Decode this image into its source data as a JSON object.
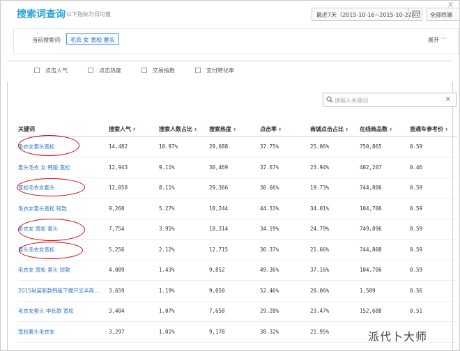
{
  "header": {
    "title": "搜索词查询",
    "subtitle": "以下指标为日均值",
    "date_range": "最近7天（2015-10-16~2015-10-22）",
    "terminal": "全部终端",
    "close": "X"
  },
  "current_search": {
    "label": "当前搜索词:",
    "tag": "毛衣 女 宽松 套头",
    "expand": "展开"
  },
  "filters": [
    {
      "label": "点击人气"
    },
    {
      "label": "点击热度"
    },
    {
      "label": "交易指数"
    },
    {
      "label": "支付转化率"
    }
  ],
  "search": {
    "placeholder": "请输入关键词",
    "clear": "×"
  },
  "table": {
    "headers": [
      "关键词",
      "搜索人气",
      "搜索人数占比",
      "搜索热度",
      "点击率",
      "商城点击占比",
      "在线商品数",
      "直通车参考价"
    ],
    "sortable": [
      false,
      true,
      true,
      true,
      true,
      true,
      true,
      true
    ],
    "rows": [
      [
        "毛衣女套头宽松",
        "14,482",
        "10.97%",
        "29,688",
        "37.75%",
        "25.06%",
        "750,865",
        "0.59"
      ],
      [
        "套头毛衣 女 韩版 宽松",
        "12,943",
        "9.11%",
        "30,469",
        "37.67%",
        "23.94%",
        "402,207",
        "0.46"
      ],
      [
        "宽松毛衣女套头",
        "12,058",
        "8.11%",
        "29,366",
        "30.66%",
        "19.73%",
        "744,806",
        "0.59"
      ],
      [
        "毛衣女套头宽松 短款",
        "9,260",
        "5.27%",
        "18,244",
        "44.33%",
        "34.01%",
        "104,706",
        "0.59"
      ],
      [
        "毛衣女 宽松 套头",
        "7,754",
        "3.95%",
        "18,314",
        "34.19%",
        "24.79%",
        "749,896",
        "0.59"
      ],
      [
        "套头毛衣女宽松",
        "5,256",
        "2.12%",
        "12,715",
        "36.37%",
        "21.66%",
        "744,808",
        "0.59"
      ],
      [
        "毛衣女 宽松 套头 短款",
        "4,089",
        "1.43%",
        "9,852",
        "49.36%",
        "37.16%",
        "104,706",
        "0.59"
      ],
      [
        "2015秋装新款韩版下摆开叉半高…",
        "3,659",
        "1.19%",
        "9,050",
        "52.46%",
        "20.06%",
        "1,589",
        "0.56"
      ],
      [
        "毛衣女套头 中长款 宽松",
        "3,404",
        "1.07%",
        "7,658",
        "29.28%",
        "23.47%",
        "152,688",
        "0.51"
      ],
      [
        "宽松套头毛衣女",
        "3,297",
        "1.01%",
        "9,178",
        "38.32%",
        "21.95%",
        "",
        ""
      ]
    ]
  },
  "watermark": "派代卜大师",
  "colors": {
    "accent": "#2ca3d8",
    "link": "#2b73c2",
    "highlight_circle": "#d40000"
  }
}
